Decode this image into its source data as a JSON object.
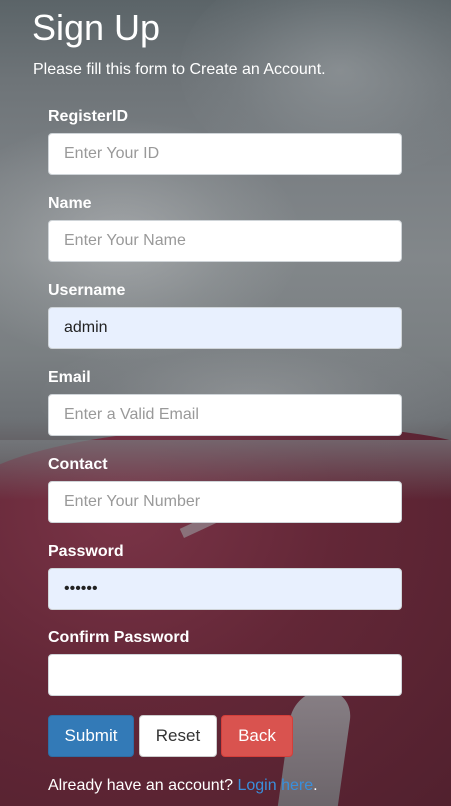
{
  "header": {
    "title": "Sign Up",
    "subtitle": "Please fill this form to Create an Account."
  },
  "form": {
    "fields": [
      {
        "label": "RegisterID",
        "placeholder": "Enter Your ID",
        "value": ""
      },
      {
        "label": "Name",
        "placeholder": "Enter Your Name",
        "value": ""
      },
      {
        "label": "Username",
        "placeholder": "",
        "value": "admin"
      },
      {
        "label": "Email",
        "placeholder": "Enter a Valid Email",
        "value": ""
      },
      {
        "label": "Contact",
        "placeholder": "Enter Your Number",
        "value": ""
      },
      {
        "label": "Password",
        "placeholder": "",
        "value": "••••••"
      },
      {
        "label": "Confirm Password",
        "placeholder": "",
        "value": ""
      }
    ]
  },
  "buttons": {
    "submit": "Submit",
    "reset": "Reset",
    "back": "Back"
  },
  "footer": {
    "prompt": "Already have an account?",
    "link": "Login here",
    "suffix": "."
  },
  "colors": {
    "autofill_bg": "#e8f0fe",
    "submit": "#337ab7",
    "back": "#d9534f",
    "link": "#3a8fdc"
  }
}
